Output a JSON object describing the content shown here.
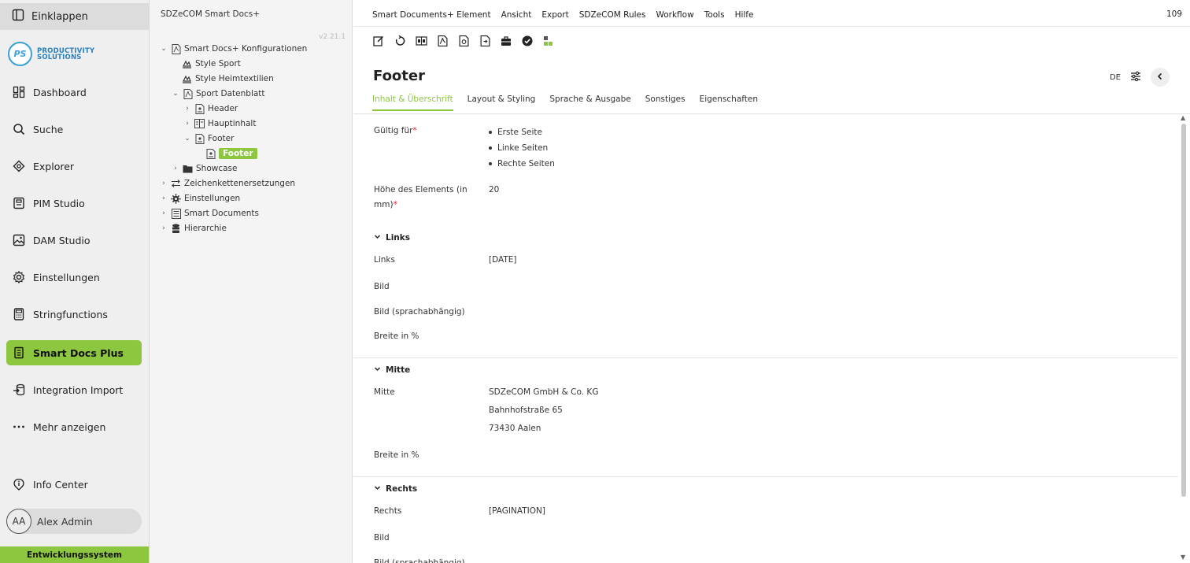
{
  "sidebar": {
    "collapse_label": "Einklappen",
    "logo": {
      "initials": "PS",
      "line1": "PRODUCTIVITY",
      "line2": "SOLUTIONS"
    },
    "items": [
      {
        "label": "Dashboard",
        "icon": "dashboard-icon"
      },
      {
        "label": "Suche",
        "icon": "search-icon"
      },
      {
        "label": "Explorer",
        "icon": "explorer-icon"
      },
      {
        "label": "PIM Studio",
        "icon": "pim-icon"
      },
      {
        "label": "DAM Studio",
        "icon": "image-icon"
      },
      {
        "label": "Einstellungen",
        "icon": "gear-icon"
      },
      {
        "label": "Stringfunctions",
        "icon": "calculator-icon"
      },
      {
        "label": "Smart Docs Plus",
        "icon": "document-icon",
        "active": true
      },
      {
        "label": "Integration Import",
        "icon": "import-icon"
      },
      {
        "label": "Mehr anzeigen",
        "icon": "more-icon"
      }
    ],
    "info_center": "Info Center",
    "user": {
      "initials": "AA",
      "name": "Alex Admin"
    },
    "environment": "Entwicklungssystem"
  },
  "tree": {
    "title": "SDZeCOM Smart Docs+",
    "version": "v2.21.1",
    "nodes": [
      {
        "label": "Smart Docs+ Konfigurationen"
      },
      {
        "label": "Style Sport"
      },
      {
        "label": "Style Heimtextilien"
      },
      {
        "label": "Sport Datenblatt"
      },
      {
        "label": "Header"
      },
      {
        "label": "Hauptinhalt"
      },
      {
        "label": "Footer"
      },
      {
        "label": "Footer"
      },
      {
        "label": "Showcase"
      },
      {
        "label": "Zeichenkettenersetzungen"
      },
      {
        "label": "Einstellungen"
      },
      {
        "label": "Smart Documents"
      },
      {
        "label": "Hierarchie"
      }
    ]
  },
  "menubar": {
    "items": [
      "Smart Documents+ Element",
      "Ansicht",
      "Export",
      "SDZeCOM Rules",
      "Workflow",
      "Tools",
      "Hilfe"
    ],
    "count": "109"
  },
  "header": {
    "title": "Footer",
    "language": "DE"
  },
  "tabs": [
    "Inhalt & Überschrift",
    "Layout & Styling",
    "Sprache & Ausgabe",
    "Sonstiges",
    "Eigenschaften"
  ],
  "form": {
    "valid_for_label": "Gültig für",
    "valid_for_values": [
      "Erste Seite",
      "Linke Seiten",
      "Rechte Seiten"
    ],
    "height_label_line1": "Höhe des Elements (in",
    "height_label_line2": "mm)",
    "height_value": "20",
    "sections": {
      "links": {
        "title": "Links",
        "links_label": "Links",
        "links_value": "[DATE]",
        "bild_label": "Bild",
        "bild_lang_label": "Bild (sprachabhängig)",
        "breite_label": "Breite in %"
      },
      "mitte": {
        "title": "Mitte",
        "mitte_label": "Mitte",
        "mitte_lines": [
          "SDZeCOM GmbH & Co. KG",
          "Bahnhofstraße 65",
          "73430 Aalen"
        ],
        "breite_label": "Breite in %"
      },
      "rechts": {
        "title": "Rechts",
        "rechts_label": "Rechts",
        "rechts_value": "[PAGINATION]",
        "bild_label": "Bild",
        "bild_lang_label": "Bild (sprachabhängig)"
      }
    }
  },
  "colors": {
    "accent": "#8dc63f",
    "required": "#e0242a",
    "logo": "#3aa0d8"
  }
}
